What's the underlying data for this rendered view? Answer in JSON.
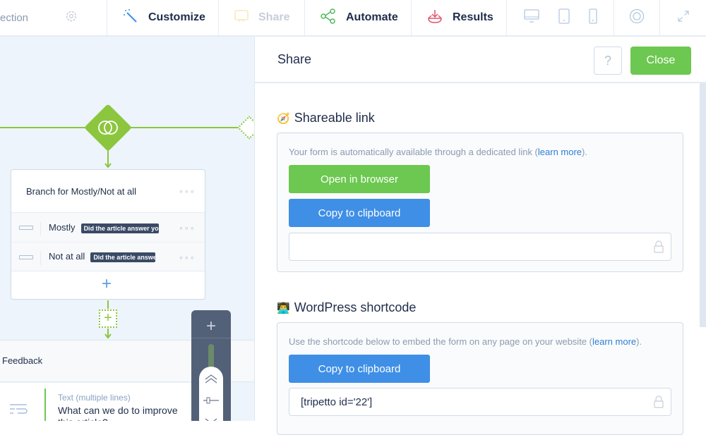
{
  "topbar": {
    "section_label": "ection",
    "tabs": [
      {
        "label": "Customize",
        "icon": "magic-wand-icon",
        "disabled": false
      },
      {
        "label": "Share",
        "icon": "cast-icon",
        "disabled": true
      },
      {
        "label": "Automate",
        "icon": "share-nodes-icon",
        "disabled": false
      },
      {
        "label": "Results",
        "icon": "download-tray-icon",
        "disabled": false
      }
    ],
    "device_icons": [
      "desktop-icon",
      "tablet-icon",
      "phone-icon"
    ],
    "help_icon": "lifebuoy-icon",
    "fullscreen_icon": "expand-icon"
  },
  "canvas": {
    "branch_card": {
      "title": "Branch for Mostly/Not at all",
      "conditions": [
        {
          "label": "Mostly",
          "tag": "Did the article answer yo"
        },
        {
          "label": "Not at all",
          "tag": "Did the article answer"
        }
      ]
    },
    "section_title": "Feedback",
    "block": {
      "type": "Text (multiple lines)",
      "question": "What can we do to improve",
      "question_cont": "this article?"
    }
  },
  "panel": {
    "title": "Share",
    "help_label": "?",
    "close_label": "Close",
    "shareable": {
      "emoji": "🧭",
      "title": "Shareable link",
      "desc": "Your form is automatically available through a dedicated link (",
      "link": "learn more",
      "desc_end": ").",
      "open_label": "Open in browser",
      "copy_label": "Copy to clipboard",
      "url_value": ""
    },
    "wordpress": {
      "emoji": "👨‍💻",
      "title": "WordPress shortcode",
      "desc": "Use the shortcode below to embed the form on any page on your website (",
      "link": "learn more",
      "desc_end": ").",
      "copy_label": "Copy to clipboard",
      "shortcode_value": "[tripetto id='22']"
    }
  },
  "colors": {
    "accent_green": "#6cc850",
    "accent_blue": "#3f8fe6",
    "flow_green": "#8cc63f",
    "results_red": "#e0536a"
  }
}
